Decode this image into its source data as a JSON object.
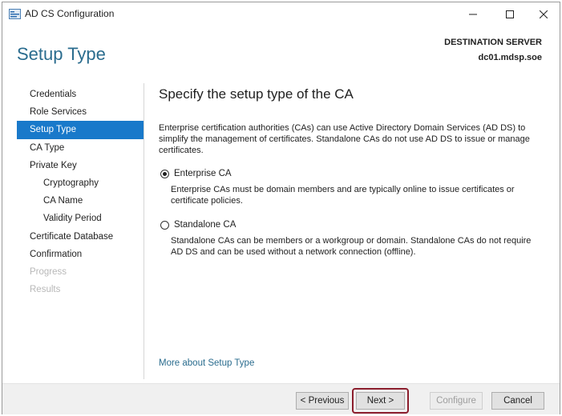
{
  "window": {
    "title": "AD CS Configuration"
  },
  "header": {
    "page_title": "Setup Type",
    "destination_label": "DESTINATION SERVER",
    "destination_server": "dc01.mdsp.soe"
  },
  "nav": {
    "items": [
      {
        "label": "Credentials"
      },
      {
        "label": "Role Services"
      },
      {
        "label": "Setup Type"
      },
      {
        "label": "CA Type"
      },
      {
        "label": "Private Key"
      },
      {
        "label": "Cryptography"
      },
      {
        "label": "CA Name"
      },
      {
        "label": "Validity Period"
      },
      {
        "label": "Certificate Database"
      },
      {
        "label": "Confirmation"
      },
      {
        "label": "Progress"
      },
      {
        "label": "Results"
      }
    ]
  },
  "content": {
    "heading": "Specify the setup type of the CA",
    "description": "Enterprise certification authorities (CAs) can use Active Directory Domain Services (AD DS) to simplify the management of certificates. Standalone CAs do not use AD DS to issue or manage certificates.",
    "options": [
      {
        "label": "Enterprise CA",
        "selected": true,
        "description": "Enterprise CAs must be domain members and are typically online to issue certificates or certificate policies."
      },
      {
        "label": "Standalone CA",
        "selected": false,
        "description": "Standalone CAs can be members or a workgroup or domain. Standalone CAs do not require AD DS and can be used without a network connection (offline)."
      }
    ],
    "more_link": "More about Setup Type"
  },
  "footer": {
    "previous_label": "< Previous",
    "next_label": "Next >",
    "configure_label": "Configure",
    "cancel_label": "Cancel"
  },
  "colors": {
    "accent": "#1979ca",
    "title_blue": "#2a6c8e",
    "highlight": "#8b1d2c"
  }
}
